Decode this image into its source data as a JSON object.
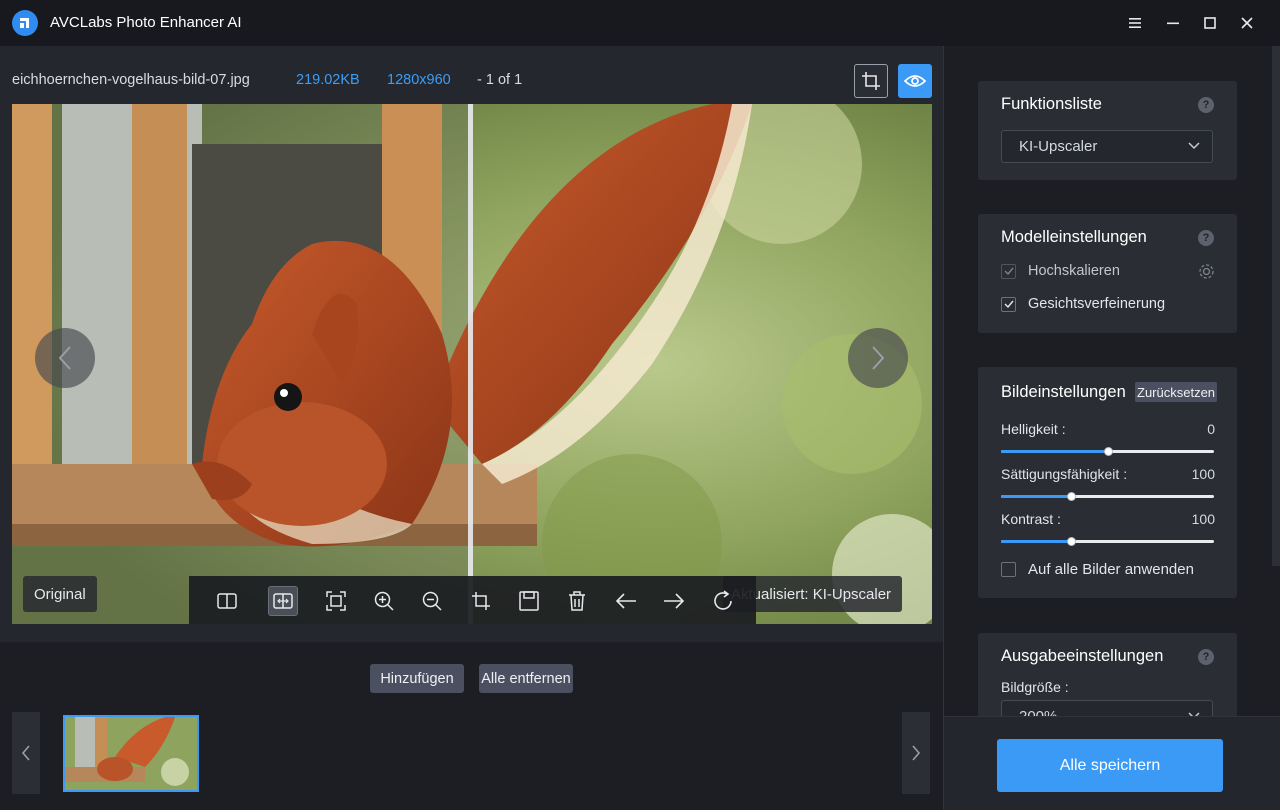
{
  "app": {
    "title": "AVCLabs Photo Enhancer AI"
  },
  "file": {
    "name": "eichhoernchen-vogelhaus-bild-07.jpg",
    "size": "219.02KB",
    "dimensions": "1280x960",
    "count": "- 1 of 1"
  },
  "viewer": {
    "original_label": "Original",
    "updated_label": "Aktualisiert: KI-Upscaler"
  },
  "toolbar": {
    "tools": [
      "split-view-icon",
      "compare-view-icon",
      "fit-screen-icon",
      "zoom-in-icon",
      "zoom-out-icon",
      "crop-icon",
      "save-icon",
      "delete-icon",
      "arrow-left-icon",
      "arrow-right-icon",
      "rotate-icon"
    ]
  },
  "actions": {
    "add_label": "Hinzufügen",
    "remove_all_label": "Alle entfernen"
  },
  "panel": {
    "functions": {
      "title": "Funktionsliste",
      "selected": "KI-Upscaler"
    },
    "model": {
      "title": "Modelleinstellungen",
      "upscale_label": "Hochskalieren",
      "upscale_checked": true,
      "face_label": "Gesichtsverfeinerung",
      "face_checked": true
    },
    "image": {
      "title": "Bildeinstellungen",
      "reset_label": "Zurücksetzen",
      "brightness_label": "Helligkeit :",
      "brightness_value": "0",
      "brightness_level": 0.5,
      "saturation_label": "Sättigungsfähigkeit :",
      "saturation_value": "100",
      "saturation_level": 0.33,
      "contrast_label": "Kontrast :",
      "contrast_value": "100",
      "contrast_level": 0.33,
      "apply_all_label": "Auf alle Bilder anwenden",
      "apply_all_checked": false
    },
    "output": {
      "title": "Ausgabeeinstellungen",
      "size_label": "Bildgröße :",
      "size_value": "200%"
    },
    "save_all_label": "Alle speichern"
  },
  "colors": {
    "accent": "#3b9af5",
    "background": "#1e2026",
    "panel": "#2a2d34"
  }
}
